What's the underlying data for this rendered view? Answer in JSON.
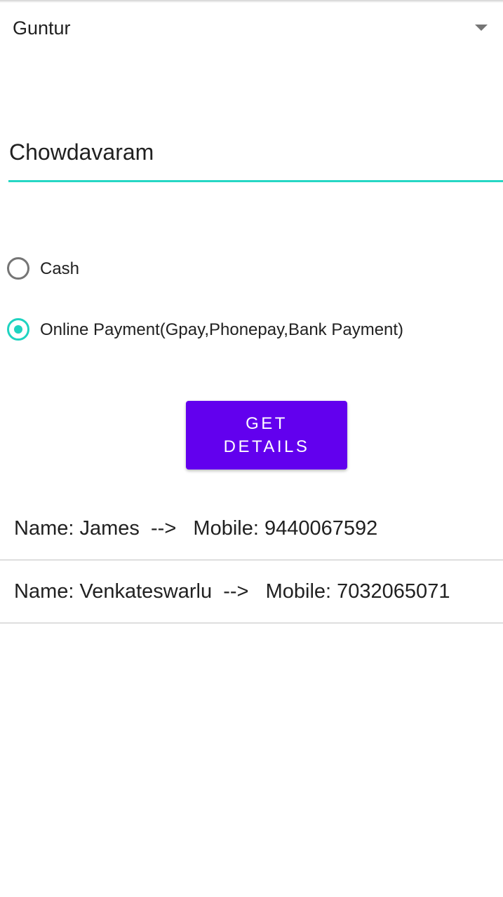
{
  "district_spinner": {
    "selected_value": "Guntur"
  },
  "village_field": {
    "value": "Chowdavaram"
  },
  "payment_options": [
    {
      "label": "Cash",
      "checked": false
    },
    {
      "label": "Online Payment(Gpay,Phonepay,Bank Payment)",
      "checked": true
    }
  ],
  "get_details_button": {
    "label": "GET DETAILS"
  },
  "results": [
    {
      "text": "Name: James  -->   Mobile: 9440067592"
    },
    {
      "text": "Name: Venkateswarlu  -->   Mobile: 7032065071"
    }
  ],
  "colors": {
    "accent": "#1fd3c0",
    "button": "#6200ee"
  },
  "icons": {
    "dropdown": "dropdown-arrow-icon",
    "radio": "radio-button-icon"
  }
}
